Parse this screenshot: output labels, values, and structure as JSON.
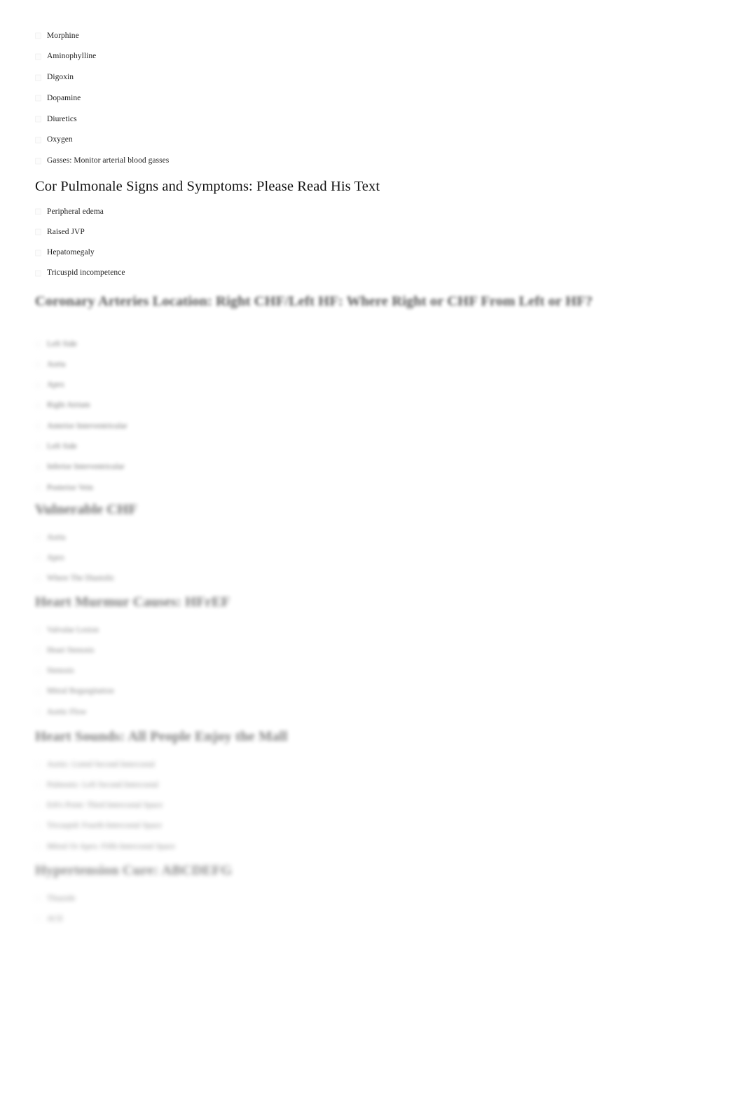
{
  "document": {
    "type": "study-notes-checklist",
    "background_color": "#ffffff",
    "text_color": "#222222",
    "heading_color": "#111111"
  },
  "sections": [
    {
      "id": "treatment-drugs",
      "heading": null,
      "legible": true,
      "items": [
        "Morphine",
        "Aminophylline",
        "Digoxin",
        "Dopamine",
        "Diuretics",
        "Oxygen",
        "Gasses: Monitor arterial blood gasses"
      ]
    },
    {
      "id": "cor-pulmonale",
      "heading": "Cor Pulmonale Signs and Symptoms: Please Read His Text",
      "legible": true,
      "items": [
        "Peripheral edema",
        "Raised JVP",
        "Hepatomegaly",
        "Tricuspid incompetence"
      ]
    },
    {
      "id": "coronary-arteries-location",
      "heading": "Coronary Arteries Location: Right CHF/Left HF: Where Right or CHF From Left or HF?",
      "legible": false,
      "blur_level": 1,
      "items": [
        "Left Side",
        "Aorta",
        "Apex",
        "Right Atrium",
        "Anterior Interventricular",
        "Left Side",
        "Inferior Interventricular",
        "Posterior Vein"
      ]
    },
    {
      "id": "vulnerable-chf",
      "heading": "Vulnerable CHF",
      "legible": false,
      "blur_level": 3,
      "items": [
        "Aorta",
        "Apex",
        "Where The Diastolic"
      ]
    },
    {
      "id": "heart-murmur-causes",
      "heading": "Heart Murmur Causes: HFrEF",
      "legible": false,
      "blur_level": 4,
      "items": [
        "Valvular Lesion",
        "Heart Stenosis",
        "Stenosis",
        "Mitral Regurgitation",
        "Aortic Flow"
      ]
    },
    {
      "id": "heart-sounds",
      "heading": "Heart Sounds: All People Enjoy the Mall",
      "legible": false,
      "blur_level": 5,
      "items": [
        "Aortic: Listed Second Intercostal",
        "Pulmonic: Left Second Intercostal",
        "Erb's Point: Third Intercostal Space",
        "Tricuspid: Fourth Intercostal Space",
        "Mitral Or Apex: Fifth Intercostal Space"
      ]
    },
    {
      "id": "hypertension-cure",
      "heading": "Hypertension Cure: ABCDEFG",
      "legible": false,
      "blur_level": 7,
      "items": [
        "Thiazide",
        "ACE"
      ]
    }
  ]
}
